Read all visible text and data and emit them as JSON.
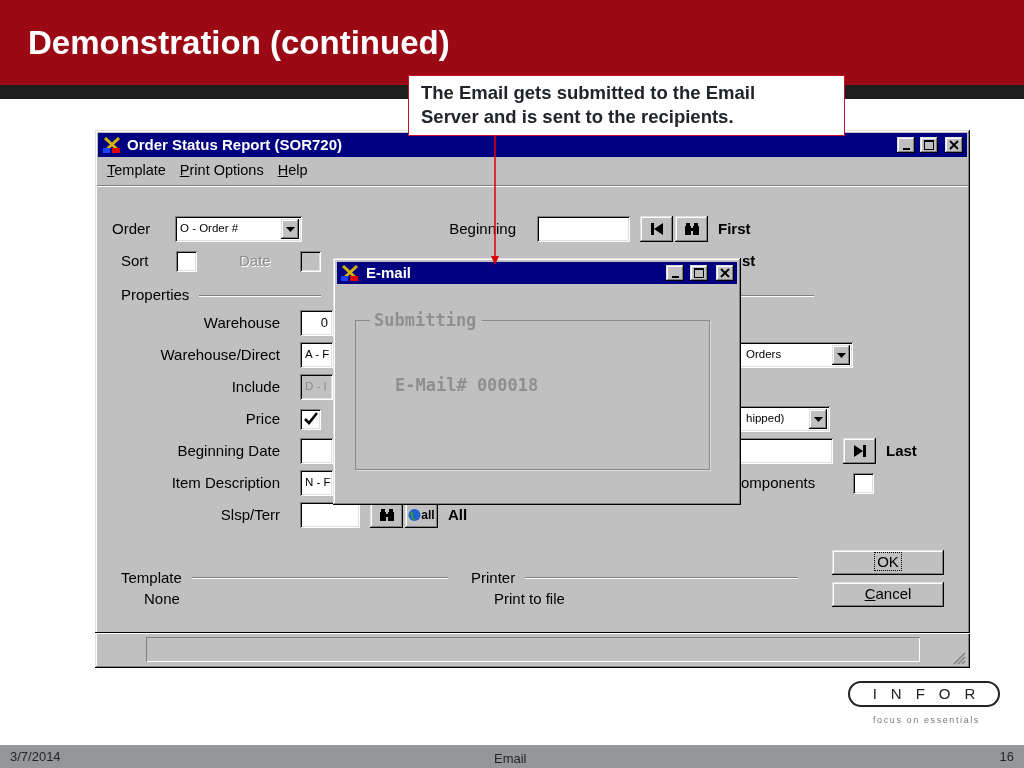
{
  "slide": {
    "title": "Demonstration (continued)",
    "callout": "The Email gets submitted to the Email Server and is sent to the recipients."
  },
  "window": {
    "title": "Order Status Report (SOR720)",
    "menu": [
      "Template",
      "Print Options",
      "Help"
    ]
  },
  "form": {
    "order": {
      "label": "Order",
      "value": "O - Order #"
    },
    "sort": {
      "label": "Sort",
      "checked": false
    },
    "date": {
      "label": "Date",
      "checked": false,
      "disabled": true
    },
    "beginning": {
      "label": "Beginning",
      "range_label": "First"
    },
    "ending": {
      "range_label": "st"
    },
    "properties": {
      "title": "Properties",
      "rows": [
        {
          "kind": "text",
          "label": "Warehouse",
          "value": "0",
          "disabled": false
        },
        {
          "kind": "dropdown",
          "label": "Warehouse/Direct",
          "value": "A - F",
          "disabled": false,
          "right": {
            "kind": "dropdown",
            "value": "Orders"
          }
        },
        {
          "kind": "dropdown",
          "label": "Include",
          "value": "D - I",
          "disabled": true
        },
        {
          "kind": "checkbox",
          "label": "Price",
          "checked": true,
          "disabled": false,
          "right": {
            "kind": "dropdown",
            "value": "hipped)"
          }
        },
        {
          "kind": "text",
          "label": "Beginning Date",
          "disabled": false,
          "right": {
            "kind": "range_end",
            "label": "Last"
          }
        },
        {
          "kind": "dropdown",
          "label": "Item Description",
          "value": "N - F",
          "disabled": false,
          "right": {
            "kind": "checkbox",
            "label": "omponents",
            "checked": false
          }
        }
      ]
    },
    "slsp": {
      "label": "Slsp/Terr",
      "globe_text": "all",
      "all_label": "All"
    },
    "template": {
      "title": "Template",
      "value": "None"
    },
    "printer": {
      "title": "Printer",
      "value": "Print to file"
    },
    "buttons": [
      {
        "label": "OK",
        "focused": true,
        "mnemonic": false
      },
      {
        "label": "Cancel",
        "focused": false,
        "mnemonic": true
      }
    ]
  },
  "dialog": {
    "title": "E-mail",
    "group": "Submitting",
    "message": "E-Mail# 000018"
  },
  "footer": {
    "date": "3/7/2014",
    "topic": "Email",
    "page": "16"
  },
  "logo": {
    "wordmark": "INFOR",
    "tagline": "focus on essentials"
  }
}
